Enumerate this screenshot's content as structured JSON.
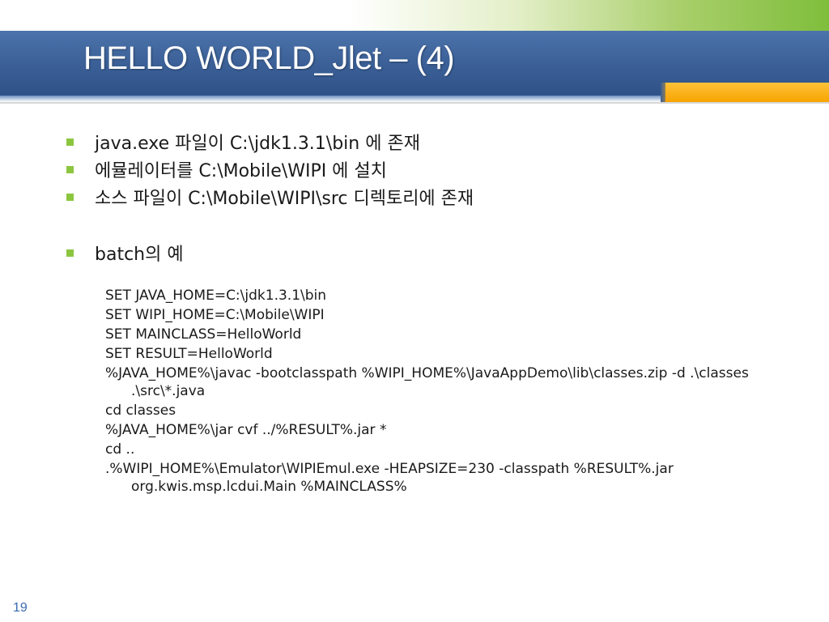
{
  "slide": {
    "title": "HELLO WORLD_Jlet – (4)",
    "page_number": "19"
  },
  "colors": {
    "title_band": "#3a5f96",
    "title_text": "#ffffff",
    "accent_orange": "#f7a400",
    "accent_green": "#8cc63f",
    "bullet_marker": "#8cc63f",
    "page_number": "#3a6ab0"
  },
  "bullets": [
    "java.exe 파일이 C:\\jdk1.3.1\\bin 에 존재",
    "에뮬레이터를 C:\\Mobile\\WIPI 에 설치",
    "소스 파일이 C:\\Mobile\\WIPI\\src 디렉토리에 존재",
    "batch의 예"
  ],
  "code_lines": [
    "SET JAVA_HOME=C:\\jdk1.3.1\\bin",
    "SET WIPI_HOME=C:\\Mobile\\WIPI",
    "SET MAINCLASS=HelloWorld",
    "SET RESULT=HelloWorld",
    "%JAVA_HOME%\\javac -bootclasspath %WIPI_HOME%\\JavaAppDemo\\lib\\classes.zip -d .\\classes .\\src\\*.java",
    "cd classes",
    "%JAVA_HOME%\\jar cvf ../%RESULT%.jar *",
    "cd ..",
    ".%WIPI_HOME%\\Emulator\\WIPIEmul.exe -HEAPSIZE=230 -classpath %RESULT%.jar org.kwis.msp.lcdui.Main %MAINCLASS%"
  ]
}
